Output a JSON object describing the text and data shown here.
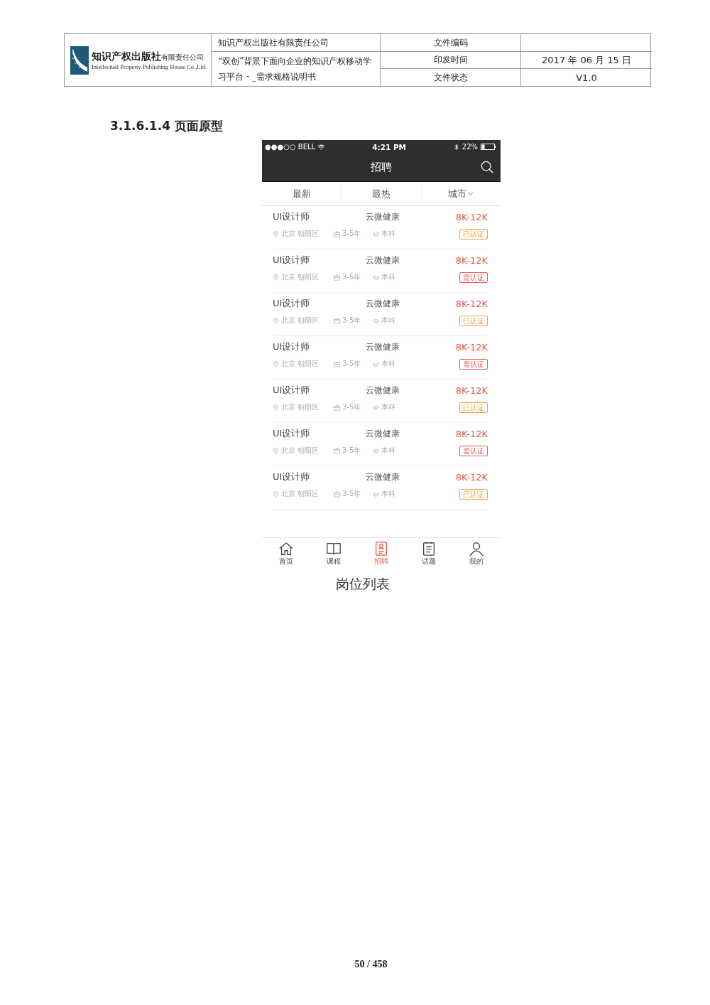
{
  "header": {
    "logo_name": "知识产权出版社",
    "logo_suffix": "有限责任公司",
    "logo_english": "Intellectual Property Publishing House Co.,Ltd.",
    "company": "知识产权出版社有限责任公司",
    "doc_title": "“双创”背景下面向企业的知识产权移动学习平台・_需求规格说明书",
    "fields": [
      {
        "label": "文件编码"
      },
      {
        "label": "印发时间",
        "value": "2017 年 06 月 15 日"
      },
      {
        "label": "文件状态",
        "value": "V1.0"
      }
    ]
  },
  "section_heading": "3.1.6.1.4 页面原型",
  "phone": {
    "status_bar": {
      "carrier": "●●●○○ BELL",
      "time": "4:21 PM",
      "battery": "22%"
    },
    "nav_title": "招聘",
    "filters": [
      {
        "label": "最新",
        "dropdown": false
      },
      {
        "label": "最热",
        "dropdown": false
      },
      {
        "label": "城市",
        "dropdown": true
      }
    ],
    "jobs": [
      {
        "title": "UI设计师",
        "company": "云微健康",
        "salary": "8K-12K",
        "location": "北京 朝阳区",
        "experience": "3-5年",
        "education": "本科",
        "tag": {
          "text": "已认证",
          "kind": "verified"
        }
      },
      {
        "title": "UI设计师",
        "company": "云微健康",
        "salary": "8K-12K",
        "location": "北京 朝阳区",
        "experience": "3-5年",
        "education": "本科",
        "tag": {
          "text": "需认证",
          "kind": "required"
        }
      },
      {
        "title": "UI设计师",
        "company": "云微健康",
        "salary": "8K-12K",
        "location": "北京 朝阳区",
        "experience": "3-5年",
        "education": "本科",
        "tag": {
          "text": "已认证",
          "kind": "verified"
        }
      },
      {
        "title": "UI设计师",
        "company": "云微健康",
        "salary": "8K-12K",
        "location": "北京 朝阳区",
        "experience": "3-5年",
        "education": "本科",
        "tag": {
          "text": "需认证",
          "kind": "required"
        }
      },
      {
        "title": "UI设计师",
        "company": "云微健康",
        "salary": "8K-12K",
        "location": "北京 朝阳区",
        "experience": "3-5年",
        "education": "本科",
        "tag": {
          "text": "已认证",
          "kind": "verified"
        }
      },
      {
        "title": "UI设计师",
        "company": "云微健康",
        "salary": "8K-12K",
        "location": "北京 朝阳区",
        "experience": "3-5年",
        "education": "本科",
        "tag": {
          "text": "需认证",
          "kind": "required"
        }
      },
      {
        "title": "UI设计师",
        "company": "云微健康",
        "salary": "8K-12K",
        "location": "北京 朝阳区",
        "experience": "3-5年",
        "education": "本科",
        "tag": {
          "text": "已认证",
          "kind": "verified"
        }
      }
    ],
    "tab_bar": [
      {
        "label": "首页",
        "kind": "home",
        "selected": false
      },
      {
        "label": "课程",
        "kind": "book",
        "selected": false
      },
      {
        "label": "招聘",
        "kind": "resume",
        "selected": true
      },
      {
        "label": "话题",
        "kind": "notes",
        "selected": false
      },
      {
        "label": "我的",
        "kind": "user",
        "selected": false
      }
    ]
  },
  "caption": "岗位列表",
  "page_number": "50 / 458"
}
